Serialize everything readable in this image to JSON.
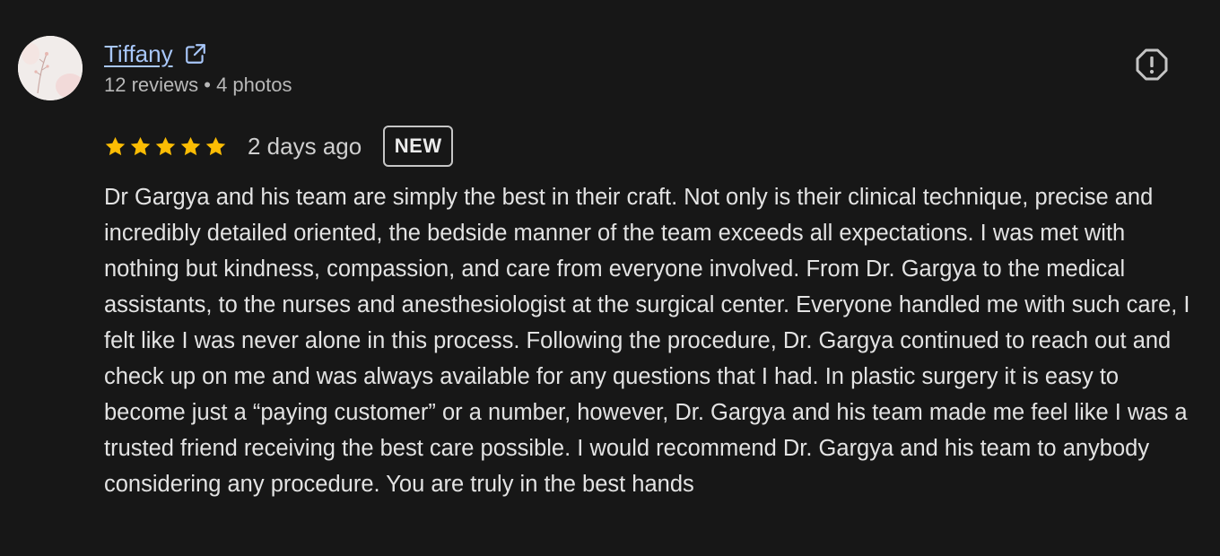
{
  "author": {
    "name": "Tiffany",
    "meta": "12 reviews • 4 photos"
  },
  "review": {
    "rating": 5,
    "max_rating": 5,
    "date": "2 days ago",
    "badge": "NEW",
    "text": "Dr Gargya and his team are simply the best in their craft. Not only is their clinical technique, precise and incredibly detailed oriented, the bedside manner of the team exceeds all expectations. I was met with nothing but kindness, compassion, and care from everyone involved. From Dr. Gargya to the medical assistants, to the nurses and anesthesiologist at the surgical center. Everyone handled me with such care, I felt like I was never alone in this process. Following the procedure, Dr. Gargya continued to reach out and check up on me and was always available for any questions that I had. In plastic surgery it is easy to become just a “paying customer” or a number, however, Dr. Gargya and his team made me feel like I was a trusted friend receiving the best care possible. I would recommend Dr. Gargya and his team to anybody considering any procedure. You are truly in the best hands"
  },
  "colors": {
    "background": "#171717",
    "link": "#a8c7fa",
    "star": "#fbbc04",
    "text": "#e3e3e3",
    "secondary_text": "#b8b8b8"
  },
  "icons": {
    "external_link": "external-link-icon",
    "report": "report-icon",
    "star": "star-icon"
  }
}
